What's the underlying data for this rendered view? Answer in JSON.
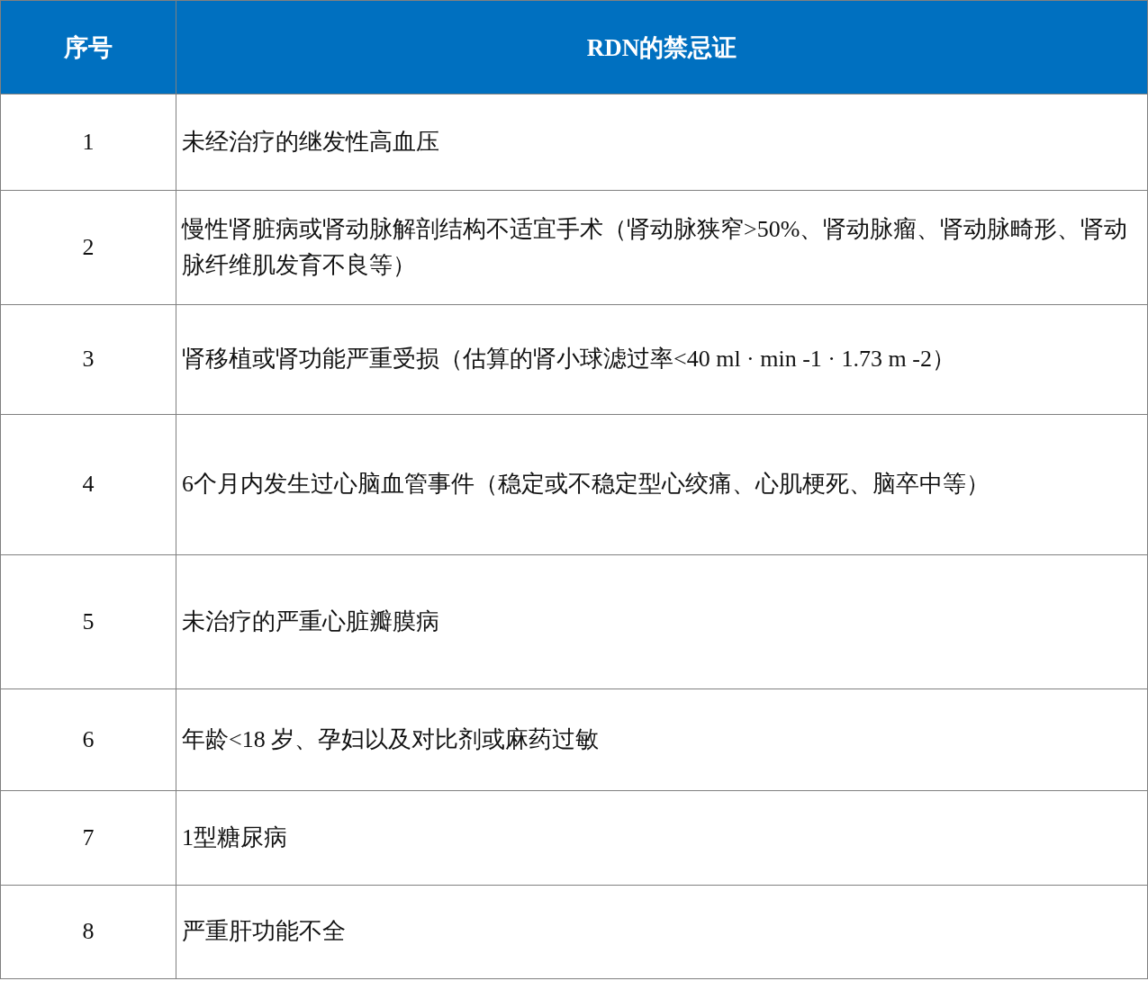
{
  "table": {
    "columns": [
      "序号",
      "RDN的禁忌证"
    ],
    "rows": [
      {
        "cells": [
          "1",
          "未经治疗的继发性高血压"
        ]
      },
      {
        "cells": [
          "2",
          "慢性肾脏病或肾动脉解剖结构不适宜手术（肾动脉狭窄>50%、肾动脉瘤、肾动脉畸形、肾动脉纤维肌发育不良等）"
        ]
      },
      {
        "cells": [
          "3",
          "肾移植或肾功能严重受损（估算的肾小球滤过率<40 ml · min -1 · 1.73 m -2）"
        ]
      },
      {
        "cells": [
          "4",
          "6个月内发生过心脑血管事件（稳定或不稳定型心绞痛、心肌梗死、脑卒中等）"
        ]
      },
      {
        "cells": [
          "5",
          "未治疗的严重心脏瓣膜病"
        ]
      },
      {
        "cells": [
          "6",
          "年龄<18 岁、孕妇以及对比剂或麻药过敏"
        ]
      },
      {
        "cells": [
          "7",
          "1型糖尿病"
        ]
      },
      {
        "cells": [
          "8",
          "严重肝功能不全"
        ]
      }
    ]
  }
}
